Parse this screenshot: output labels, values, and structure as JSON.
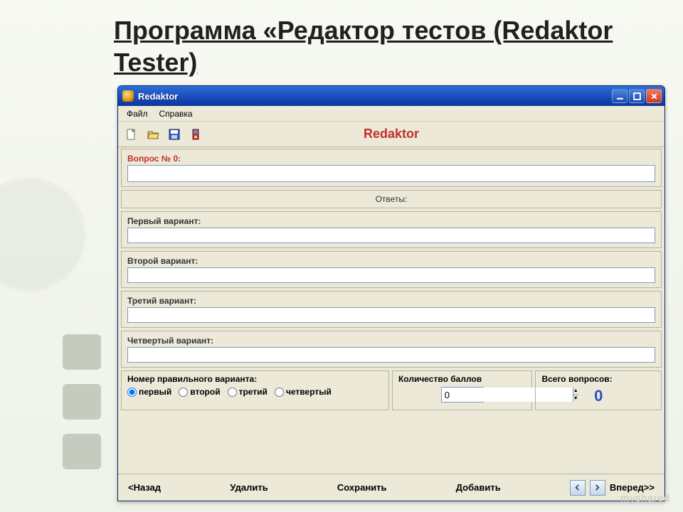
{
  "slide": {
    "title": "Программа «Редактор тестов (Redaktor Tester)"
  },
  "window": {
    "title": "Redaktor"
  },
  "menu": {
    "file": "Файл",
    "help": "Справка"
  },
  "toolbar": {
    "title": "Redaktor",
    "icons": {
      "new": "new-icon",
      "open": "open-icon",
      "save": "save-icon",
      "device": "device-icon"
    }
  },
  "question": {
    "label": "Вопрос № 0:",
    "value": ""
  },
  "answers": {
    "header": "Ответы:",
    "variants": [
      {
        "label": "Первый вариант:",
        "value": ""
      },
      {
        "label": "Второй вариант:",
        "value": ""
      },
      {
        "label": "Третий вариант:",
        "value": ""
      },
      {
        "label": "Четвертый вариант:",
        "value": ""
      }
    ]
  },
  "correct": {
    "label": "Номер правильного варианта:",
    "options": [
      "первый",
      "второй",
      "третий",
      "четвертый"
    ],
    "selected": 0
  },
  "score": {
    "label": "Количество баллов",
    "value": "0"
  },
  "total": {
    "label": "Всего вопросов:",
    "value": "0"
  },
  "nav": {
    "back": "<Назад",
    "delete": "Удалить",
    "save": "Сохранить",
    "add": "Добавить",
    "forward": "Вперед>>"
  },
  "watermark": "myshared"
}
